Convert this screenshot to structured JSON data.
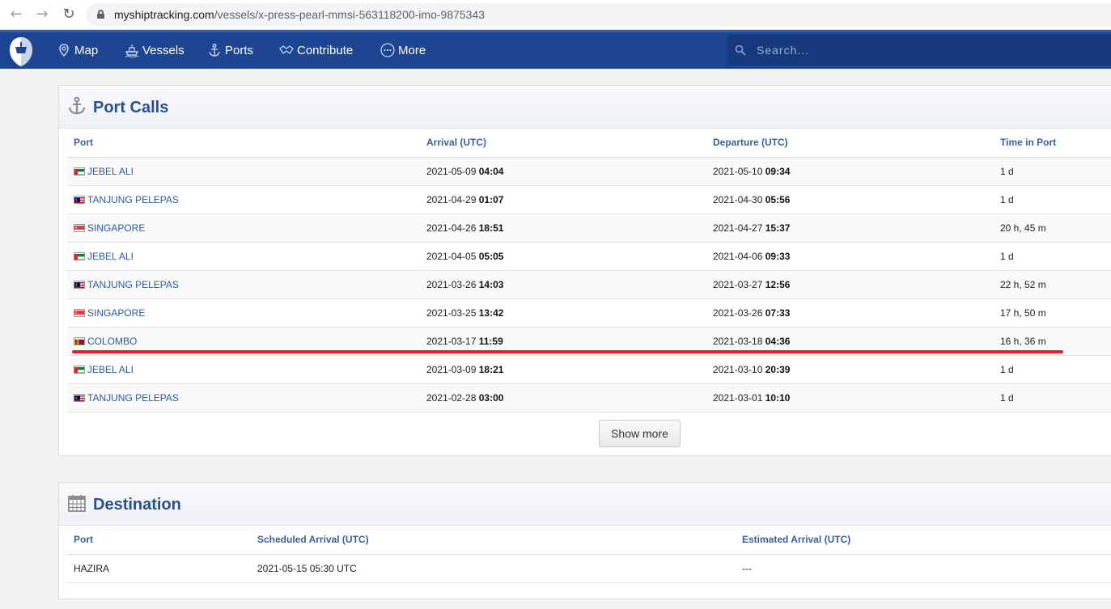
{
  "browser": {
    "url_host": "myshiptracking.com",
    "url_path": "/vessels/x-press-pearl-mmsi-563118200-imo-9875343"
  },
  "nav": {
    "items": [
      {
        "label": "Map",
        "icon": "map-pin-icon"
      },
      {
        "label": "Vessels",
        "icon": "ship-icon"
      },
      {
        "label": "Ports",
        "icon": "anchor-icon"
      },
      {
        "label": "Contribute",
        "icon": "handshake-icon"
      },
      {
        "label": "More",
        "icon": "more-dots-icon"
      }
    ],
    "search_placeholder": "Search..."
  },
  "port_calls": {
    "title": "Port Calls",
    "headers": [
      "Port",
      "Arrival (UTC)",
      "Departure (UTC)",
      "Time in Port"
    ],
    "rows": [
      {
        "flag": "uae",
        "port": "JEBEL ALI",
        "arr_date": "2021-05-09",
        "arr_time": "04:04",
        "dep_date": "2021-05-10",
        "dep_time": "09:34",
        "time": "1 d"
      },
      {
        "flag": "malaysia",
        "port": "TANJUNG PELEPAS",
        "arr_date": "2021-04-29",
        "arr_time": "01:07",
        "dep_date": "2021-04-30",
        "dep_time": "05:56",
        "time": "1 d"
      },
      {
        "flag": "singapore",
        "port": "SINGAPORE",
        "arr_date": "2021-04-26",
        "arr_time": "18:51",
        "dep_date": "2021-04-27",
        "dep_time": "15:37",
        "time": "20 h, 45 m"
      },
      {
        "flag": "uae",
        "port": "JEBEL ALI",
        "arr_date": "2021-04-05",
        "arr_time": "05:05",
        "dep_date": "2021-04-06",
        "dep_time": "09:33",
        "time": "1 d"
      },
      {
        "flag": "malaysia",
        "port": "TANJUNG PELEPAS",
        "arr_date": "2021-03-26",
        "arr_time": "14:03",
        "dep_date": "2021-03-27",
        "dep_time": "12:56",
        "time": "22 h, 52 m"
      },
      {
        "flag": "singapore",
        "port": "SINGAPORE",
        "arr_date": "2021-03-25",
        "arr_time": "13:42",
        "dep_date": "2021-03-26",
        "dep_time": "07:33",
        "time": "17 h, 50 m"
      },
      {
        "flag": "srilanka",
        "port": "COLOMBO",
        "arr_date": "2021-03-17",
        "arr_time": "11:59",
        "dep_date": "2021-03-18",
        "dep_time": "04:36",
        "time": "16 h, 36 m"
      },
      {
        "flag": "uae",
        "port": "JEBEL ALI",
        "arr_date": "2021-03-09",
        "arr_time": "18:21",
        "dep_date": "2021-03-10",
        "dep_time": "20:39",
        "time": "1 d"
      },
      {
        "flag": "malaysia",
        "port": "TANJUNG PELEPAS",
        "arr_date": "2021-02-28",
        "arr_time": "03:00",
        "dep_date": "2021-03-01",
        "dep_time": "10:10",
        "time": "1 d"
      }
    ],
    "show_more_label": "Show more",
    "highlight_color": "#e0202a"
  },
  "destination": {
    "title": "Destination",
    "headers": [
      "Port",
      "Scheduled Arrival (UTC)",
      "Estimated Arrival (UTC)"
    ],
    "row": {
      "port": "HAZIRA",
      "scheduled": "2021-05-15 05:30 UTC",
      "estimated": "---"
    }
  },
  "colors": {
    "nav_bg": "#1e4592",
    "title": "#2a4f8f",
    "header": "#3b5f99",
    "link": "#2a5aa0"
  }
}
